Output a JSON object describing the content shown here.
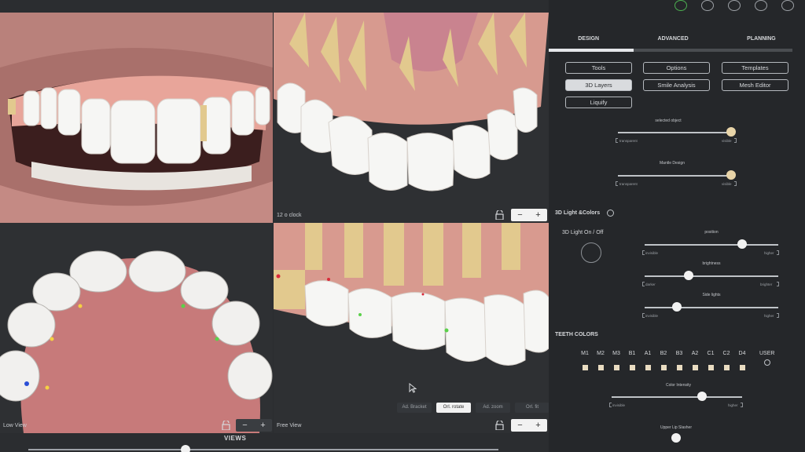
{
  "viewports": {
    "top_right_label": "12 o clock",
    "bottom_left_label": "Low View",
    "bottom_right_label": "Free View",
    "zoom_minus": "−",
    "zoom_plus": "+"
  },
  "view_toolbar": {
    "buttons": [
      "Ad. Bracket",
      "Orl. rotate",
      "Ad. zoom",
      "Orl. fit"
    ]
  },
  "views": {
    "title": "VIEWS"
  },
  "panel": {
    "tabs": [
      "DESIGN",
      "ADVANCED",
      "PLANNING"
    ],
    "buttons": {
      "tools": "Tools",
      "options": "Options",
      "templates": "Templates",
      "layers": "3D Layers",
      "smile": "Smile Analysis",
      "mesh": "Mesh Editor",
      "liquify": "Liquify"
    },
    "selected_object": {
      "label": "selected object",
      "left": "transparent",
      "right": "visible",
      "value": 0.96
    },
    "mantle": {
      "label": "Mantle Design",
      "left": "transparent",
      "right": "visible",
      "value": 0.96
    },
    "light_section": "3D Light &Colors",
    "light_toggle": "3D Light On / Off",
    "position": {
      "label": "position",
      "left": "invisible",
      "right": "higher",
      "value": 0.73
    },
    "brightness": {
      "label": "brightness",
      "left": "darker",
      "right": "brighter",
      "value": 0.34
    },
    "side_lights": {
      "label": "Side lights",
      "left": "invisible",
      "right": "higher",
      "value": 0.24
    },
    "teeth_colors": "TEETH COLORS",
    "shades": [
      "M1",
      "M2",
      "M3",
      "B1",
      "A1",
      "B2",
      "B3",
      "A2",
      "C1",
      "C2",
      "D4"
    ],
    "user_label": "USER",
    "color_intensity": {
      "label": "Color Intensity",
      "left": "invisible",
      "right": "higher",
      "value": 0.76
    },
    "upper_lip": "Upper Lip Slasher"
  },
  "colors": {
    "gum": "#e8a59a",
    "tooth": "#f6f6f4",
    "root": "#e2c98e",
    "panel_bg": "#25272a"
  }
}
